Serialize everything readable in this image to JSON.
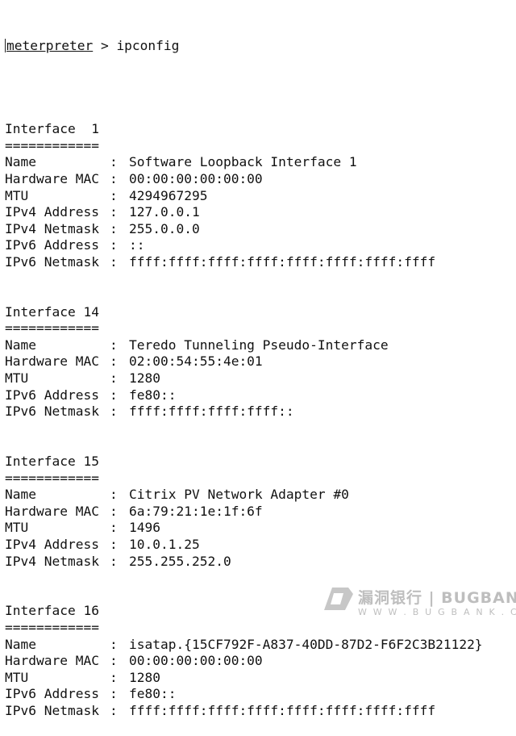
{
  "prompt": {
    "name": "meterpreter",
    "rest": " > ipconfig"
  },
  "interfaces": [
    {
      "header": "Interface  1",
      "rule": "============",
      "fields": [
        {
          "key": "Name",
          "value": "Software Loopback Interface 1"
        },
        {
          "key": "Hardware MAC",
          "value": "00:00:00:00:00:00"
        },
        {
          "key": "MTU",
          "value": "4294967295"
        },
        {
          "key": "IPv4 Address",
          "value": "127.0.0.1"
        },
        {
          "key": "IPv4 Netmask",
          "value": "255.0.0.0"
        },
        {
          "key": "IPv6 Address",
          "value": "::"
        },
        {
          "key": "IPv6 Netmask",
          "value": "ffff:ffff:ffff:ffff:ffff:ffff:ffff:ffff"
        }
      ]
    },
    {
      "header": "Interface 14",
      "rule": "============",
      "fields": [
        {
          "key": "Name",
          "value": "Teredo Tunneling Pseudo-Interface"
        },
        {
          "key": "Hardware MAC",
          "value": "02:00:54:55:4e:01"
        },
        {
          "key": "MTU",
          "value": "1280"
        },
        {
          "key": "IPv6 Address",
          "value": "fe80::"
        },
        {
          "key": "IPv6 Netmask",
          "value": "ffff:ffff:ffff:ffff::"
        }
      ]
    },
    {
      "header": "Interface 15",
      "rule": "============",
      "fields": [
        {
          "key": "Name",
          "value": "Citrix PV Network Adapter #0"
        },
        {
          "key": "Hardware MAC",
          "value": "6a:79:21:1e:1f:6f"
        },
        {
          "key": "MTU",
          "value": "1496"
        },
        {
          "key": "IPv4 Address",
          "value": "10.0.1.25"
        },
        {
          "key": "IPv4 Netmask",
          "value": "255.255.252.0"
        }
      ]
    },
    {
      "header": "Interface 16",
      "rule": "============",
      "fields": [
        {
          "key": "Name",
          "value": "isatap.{15CF792F-A837-40DD-87D2-F6F2C3B21122}"
        },
        {
          "key": "Hardware MAC",
          "value": "00:00:00:00:00:00"
        },
        {
          "key": "MTU",
          "value": "1280"
        },
        {
          "key": "IPv6 Address",
          "value": "fe80::"
        },
        {
          "key": "IPv6 Netmask",
          "value": "ffff:ffff:ffff:ffff:ffff:ffff:ffff:ffff"
        }
      ]
    }
  ],
  "separator": ":",
  "watermark": {
    "title": "漏洞银行 | BUGBANK",
    "subtitle": "W W W . B U G B A N K . C N"
  }
}
